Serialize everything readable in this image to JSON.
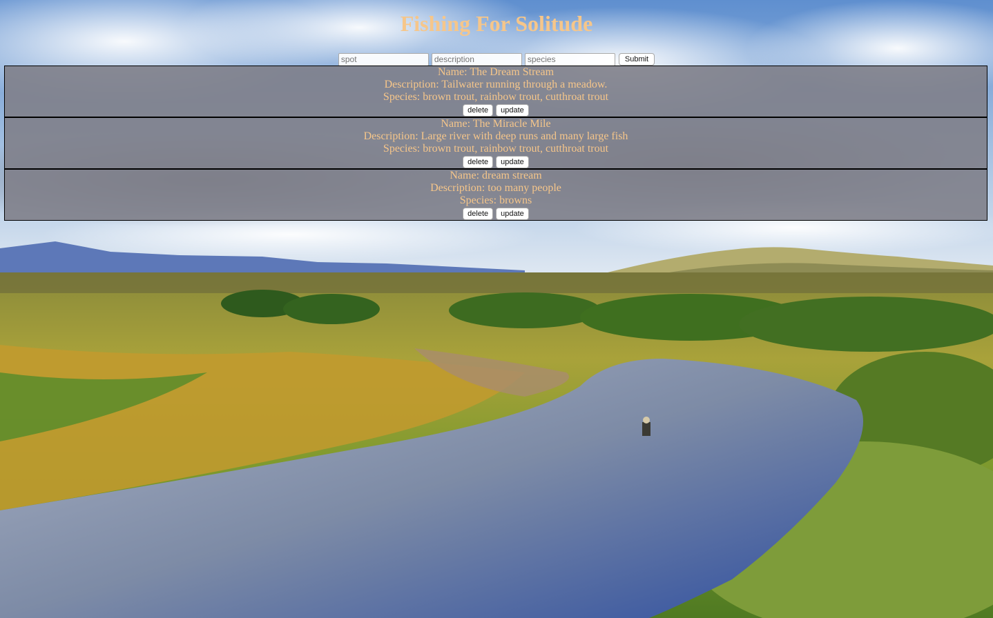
{
  "page": {
    "title": "Fishing For Solitude",
    "title_color": "#f6c68a"
  },
  "form": {
    "spot_placeholder": "spot",
    "description_placeholder": "description",
    "species_placeholder": "species",
    "submit_label": "Submit"
  },
  "spots": [
    {
      "name": "Name: The Dream Stream",
      "description": "Description: Tailwater running through a meadow.",
      "species": "Species: brown trout, rainbow trout, cutthroat trout",
      "delete_label": "delete",
      "update_label": "update"
    },
    {
      "name": "Name: The Miracle Mile",
      "description": "Description: Large river with deep runs and many large fish",
      "species": "Species: brown trout, rainbow trout, cutthroat trout",
      "delete_label": "delete",
      "update_label": "update"
    },
    {
      "name": "Name: dream stream",
      "description": "Description: too many people",
      "species": "Species: browns",
      "delete_label": "delete",
      "update_label": "update"
    }
  ]
}
